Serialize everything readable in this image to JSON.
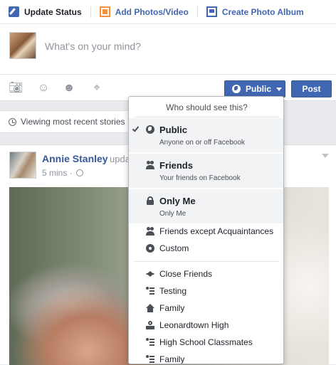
{
  "composer": {
    "tabs": [
      {
        "label": "Update Status",
        "icon": "pencil-icon"
      },
      {
        "label": "Add Photos/Video",
        "icon": "photo-icon"
      },
      {
        "label": "Create Photo Album",
        "icon": "album-icon"
      }
    ],
    "placeholder": "What's on your mind?",
    "actions": [
      "camera-icon",
      "tag-people-icon",
      "feeling-icon",
      "location-icon"
    ],
    "privacy_label": "Public",
    "post_label": "Post"
  },
  "feed": {
    "viewing_text": "Viewing most recent stories ·"
  },
  "story": {
    "author": "Annie Stanley",
    "action_fragment": "upda",
    "time": "5 mins ·"
  },
  "privacy_menu": {
    "header": "Who should see this?",
    "rich_options": [
      {
        "label": "Public",
        "description": "Anyone on or off Facebook",
        "icon": "globe-icon",
        "selected": true
      },
      {
        "label": "Friends",
        "description": "Your friends on Facebook",
        "icon": "friends-icon",
        "selected": false
      },
      {
        "label": "Only Me",
        "description": "Only Me",
        "icon": "lock-icon",
        "selected": false
      }
    ],
    "options": [
      {
        "label": "Friends except Acquaintances",
        "icon": "friends-except-icon"
      },
      {
        "label": "Custom",
        "icon": "gear-icon"
      }
    ],
    "lists": [
      {
        "label": "Close Friends",
        "icon": "star-icon"
      },
      {
        "label": "Testing",
        "icon": "list-icon"
      },
      {
        "label": "Family",
        "icon": "house-icon"
      },
      {
        "label": "Leonardtown High",
        "icon": "school-icon"
      },
      {
        "label": "High School Classmates",
        "icon": "list-icon"
      },
      {
        "label": "Family",
        "icon": "list-icon"
      }
    ]
  }
}
